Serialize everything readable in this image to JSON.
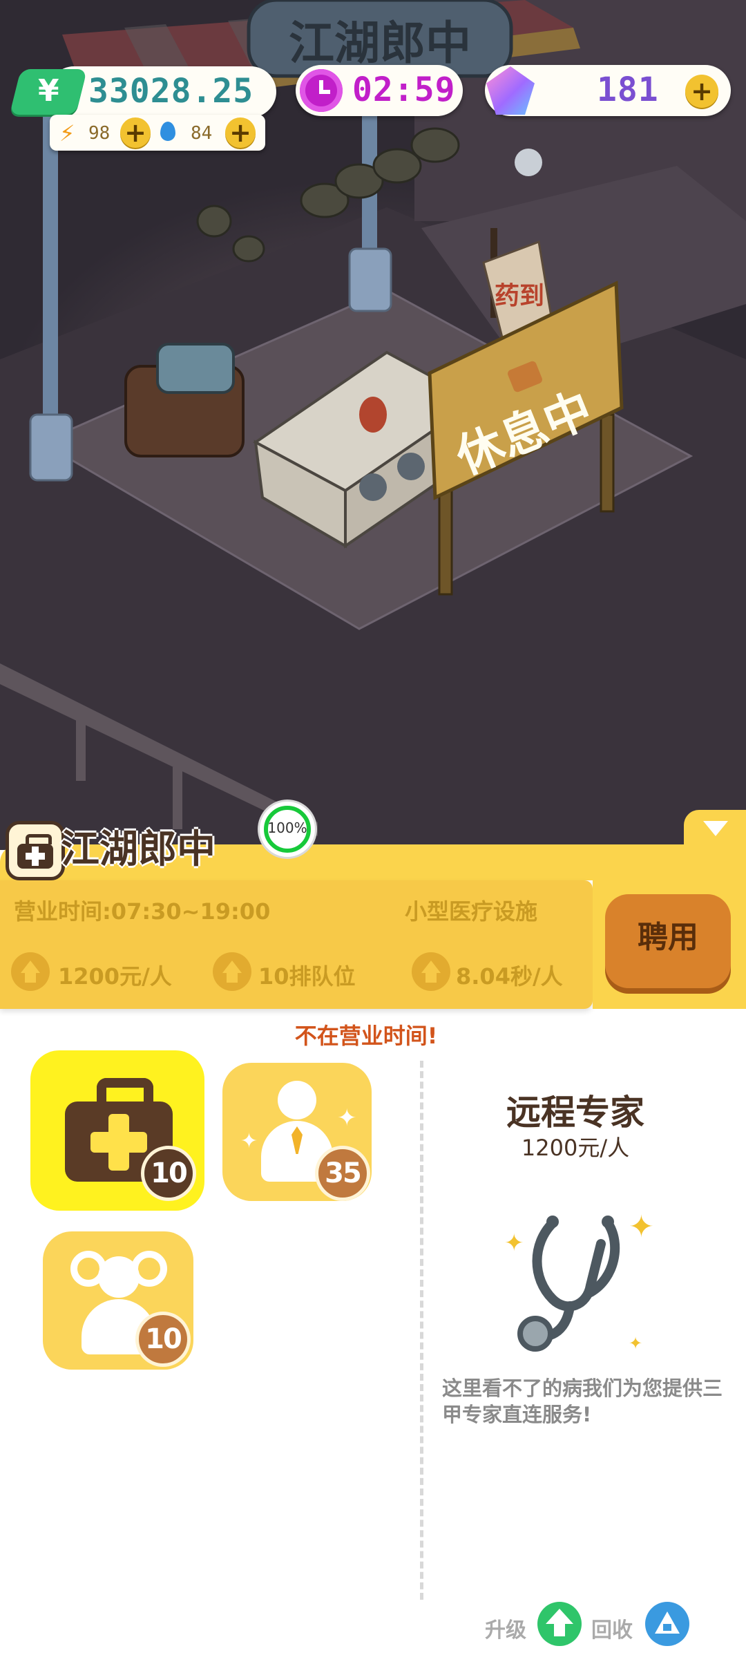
{
  "hud": {
    "money": "33028.25",
    "energy": "98",
    "water": "84",
    "timer": "02:59",
    "gems": "181",
    "money_icon": "¥"
  },
  "scene": {
    "shop_sign": "江湖郎中",
    "rest_sign": "休息中",
    "banner": "药到"
  },
  "shop": {
    "name": "江湖郎中",
    "progress": "100%",
    "progress_value": 1.0,
    "hours": "营业时间:07:30~19:00",
    "facility": "小型医疗设施",
    "price": "1200元/人",
    "queue": "10排队位",
    "speed": "8.04秒/人",
    "hire_label": "聘用",
    "status": "不在营业时间!"
  },
  "items": [
    {
      "icon": "medical-kit-icon",
      "count": "10"
    },
    {
      "icon": "staff-icon",
      "count": "35"
    },
    {
      "icon": "customers-icon",
      "count": "10"
    }
  ],
  "detail": {
    "title": "远程专家",
    "price": "1200元/人",
    "icon": "stethoscope-icon",
    "description": "这里看不了的病我们为您提供三甲专家直连服务!"
  },
  "footer": {
    "upgrade_label": "升级",
    "recycle_label": "回收"
  },
  "colors": {
    "panel_yellow": "#fbd44c",
    "card_yellow": "#f7c948",
    "hire_orange": "#d9822b",
    "money_green": "#2fbf71",
    "timer_purple": "#c11fc9",
    "gem_purple": "#7a4fd1",
    "status_red": "#d2541b"
  }
}
